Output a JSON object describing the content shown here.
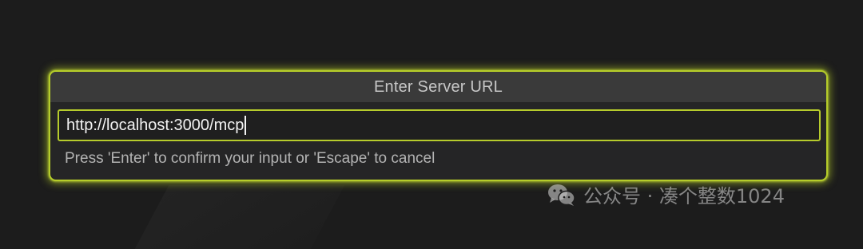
{
  "dialog": {
    "title": "Enter Server URL",
    "input_value": "http://localhost:3000/mcp",
    "hint": "Press 'Enter' to confirm your input or 'Escape' to cancel"
  },
  "watermark": {
    "text": "公众号 · 凑个整数1024",
    "icon": "wechat-logo-icon"
  },
  "colors": {
    "accent_glow": "#b5cc2a",
    "background": "#1c1c1c",
    "dialog_bg": "#252526",
    "header_bg": "#3a3a3a"
  }
}
